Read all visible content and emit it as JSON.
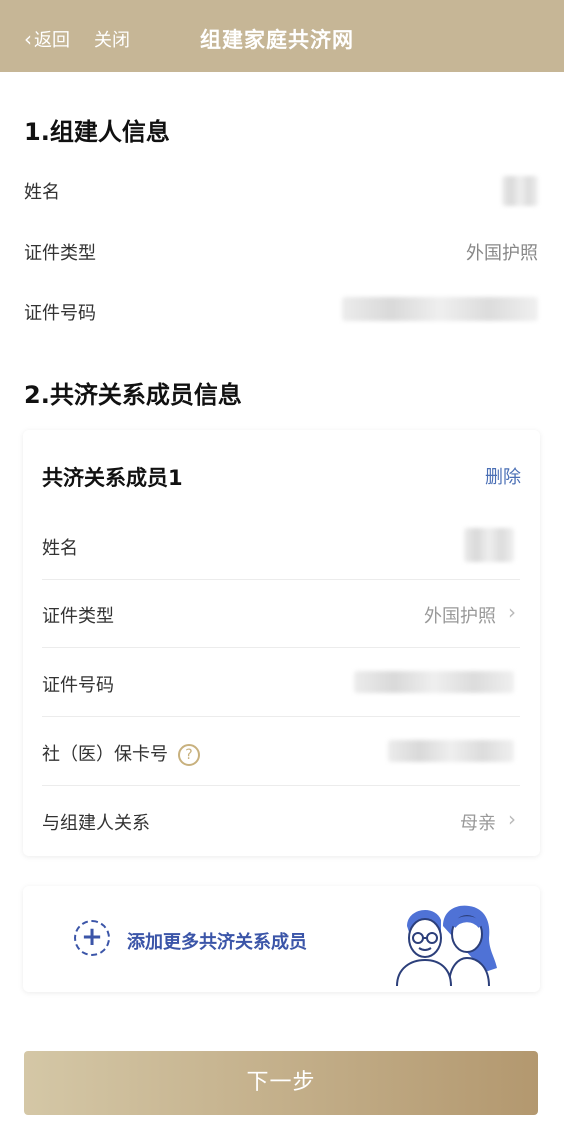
{
  "header": {
    "back_label": "返回",
    "close_label": "关闭",
    "title": "组建家庭共济网"
  },
  "section1": {
    "title": "1.组建人信息",
    "name_label": "姓名",
    "id_type_label": "证件类型",
    "id_type_value": "外国护照",
    "id_number_label": "证件号码"
  },
  "section2": {
    "title": "2.共济关系成员信息",
    "member": {
      "title": "共济关系成员1",
      "delete_label": "删除",
      "name_label": "姓名",
      "id_type_label": "证件类型",
      "id_type_value": "外国护照",
      "id_number_label": "证件号码",
      "social_card_label": "社（医）保卡号",
      "help_symbol": "?",
      "relation_label": "与组建人关系",
      "relation_value": "母亲"
    },
    "add_more_label": "添加更多共济关系成员"
  },
  "footer": {
    "next_label": "下一步"
  },
  "colors": {
    "header_bg": "#c6b696",
    "accent_blue": "#3b55a8",
    "link_blue": "#4a6fb5"
  }
}
